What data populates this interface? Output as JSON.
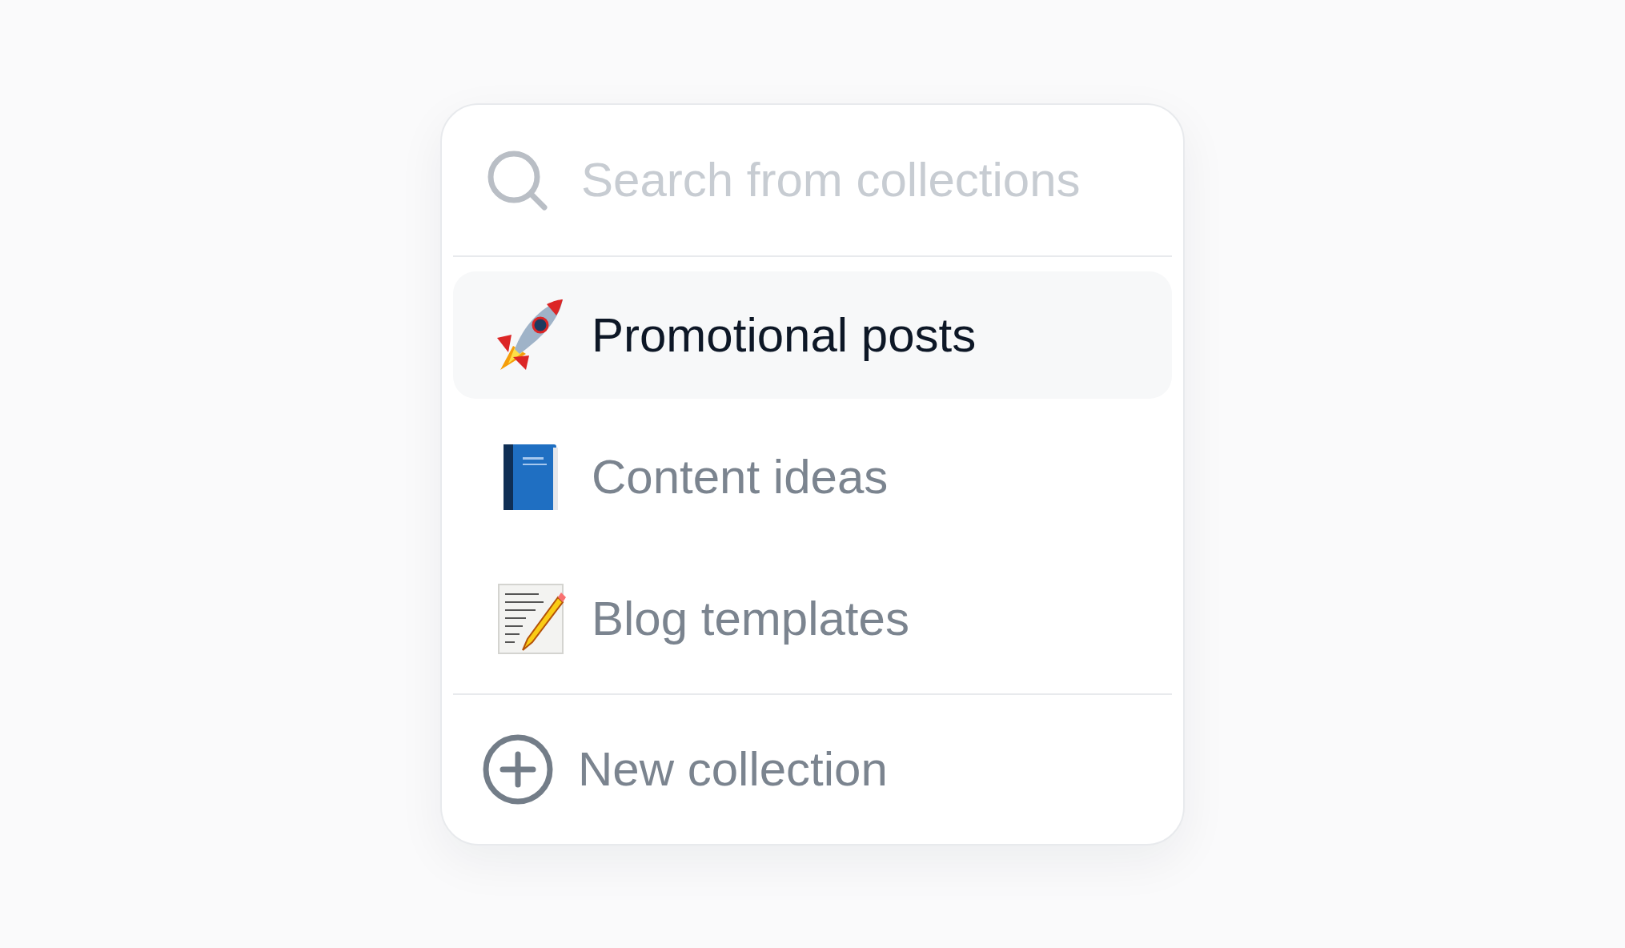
{
  "search": {
    "placeholder": "Search from collections"
  },
  "collections": [
    {
      "label": "Promotional posts",
      "selected": true,
      "kind": "rocket"
    },
    {
      "label": "Content ideas",
      "selected": false,
      "kind": "book"
    },
    {
      "label": "Blog templates",
      "selected": false,
      "kind": "notepad"
    }
  ],
  "new_collection": {
    "label": "New collection"
  }
}
